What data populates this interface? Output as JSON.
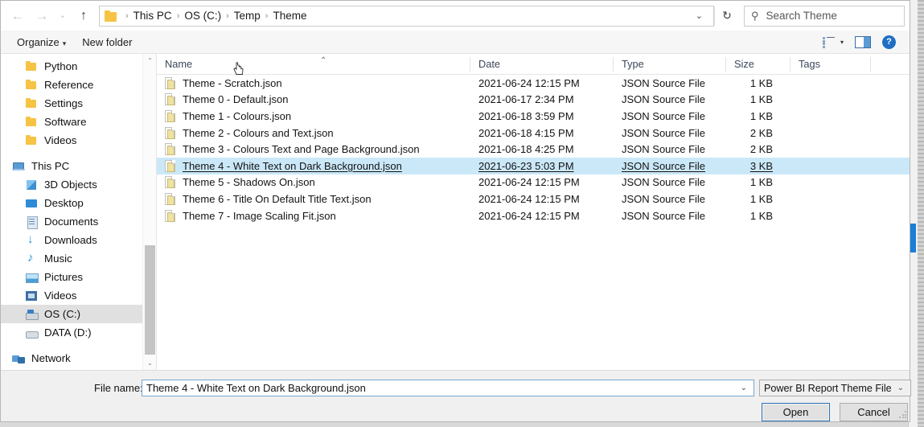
{
  "addressbar": {
    "back_icon": "arrow-left-icon",
    "forward_icon": "arrow-right-icon",
    "recent_icon": "chevron-down-icon",
    "up_icon": "arrow-up-icon",
    "folder_icon": "folder-icon",
    "breadcrumbs": [
      "This PC",
      "OS (C:)",
      "Temp",
      "Theme"
    ],
    "separator": "›",
    "dropdown_icon": "chevron-down-icon",
    "refresh_icon": "refresh-icon",
    "refresh_glyph": "↻"
  },
  "search": {
    "icon": "search-icon",
    "placeholder": "Search Theme",
    "value": ""
  },
  "commandbar": {
    "organize_label": "Organize",
    "organize_caret": "▾",
    "new_folder_label": "New folder",
    "view_icon": "view-options-icon",
    "view_caret": "▾",
    "preview_pane_icon": "preview-pane-icon",
    "help_icon": "help-icon",
    "help_glyph": "?"
  },
  "sidebar": {
    "items": [
      {
        "label": "Python",
        "icon": "folder-icon",
        "icon_class": "ic-folder",
        "level": "child",
        "selected": false
      },
      {
        "label": "Reference",
        "icon": "folder-icon",
        "icon_class": "ic-folder",
        "level": "child",
        "selected": false
      },
      {
        "label": "Settings",
        "icon": "folder-icon",
        "icon_class": "ic-folder",
        "level": "child",
        "selected": false
      },
      {
        "label": "Software",
        "icon": "folder-icon",
        "icon_class": "ic-folder",
        "level": "child",
        "selected": false
      },
      {
        "label": "Videos",
        "icon": "folder-icon",
        "icon_class": "ic-folder",
        "level": "child",
        "selected": false
      },
      {
        "label": "",
        "icon": "spacer",
        "icon_class": "",
        "level": "gap",
        "selected": false
      },
      {
        "label": "This PC",
        "icon": "this-pc-icon",
        "icon_class": "ic-pc",
        "level": "root",
        "selected": false
      },
      {
        "label": "3D Objects",
        "icon": "3d-objects-icon",
        "icon_class": "ic-3d",
        "level": "child",
        "selected": false
      },
      {
        "label": "Desktop",
        "icon": "desktop-icon",
        "icon_class": "ic-desktop",
        "level": "child",
        "selected": false
      },
      {
        "label": "Documents",
        "icon": "documents-icon",
        "icon_class": "ic-docs",
        "level": "child",
        "selected": false
      },
      {
        "label": "Downloads",
        "icon": "downloads-icon",
        "icon_class": "ic-down",
        "level": "child",
        "selected": false
      },
      {
        "label": "Music",
        "icon": "music-icon",
        "icon_class": "ic-music",
        "level": "child",
        "selected": false
      },
      {
        "label": "Pictures",
        "icon": "pictures-icon",
        "icon_class": "ic-pics",
        "level": "child",
        "selected": false
      },
      {
        "label": "Videos",
        "icon": "videos-icon",
        "icon_class": "ic-vids",
        "level": "child",
        "selected": false
      },
      {
        "label": "OS (C:)",
        "icon": "drive-icon",
        "icon_class": "ic-drive",
        "level": "child",
        "selected": true
      },
      {
        "label": "DATA (D:)",
        "icon": "drive-icon",
        "icon_class": "ic-drive2",
        "level": "child",
        "selected": false
      },
      {
        "label": "",
        "icon": "spacer",
        "icon_class": "",
        "level": "gap",
        "selected": false
      },
      {
        "label": "Network",
        "icon": "network-icon",
        "icon_class": "ic-net",
        "level": "root",
        "selected": false
      }
    ],
    "scroll_up_glyph": "⌃",
    "scroll_down_glyph": "⌄"
  },
  "filelist": {
    "sort_indicator": "⌃",
    "columns": [
      {
        "label": "Name",
        "key": "name"
      },
      {
        "label": "Date",
        "key": "date"
      },
      {
        "label": "Type",
        "key": "type"
      },
      {
        "label": "Size",
        "key": "size"
      },
      {
        "label": "Tags",
        "key": "tags"
      }
    ],
    "rows": [
      {
        "name": "Theme - Scratch.json",
        "date": "2021-06-24 12:15 PM",
        "type": "JSON Source File",
        "size": "1 KB",
        "tags": "",
        "selected": false
      },
      {
        "name": "Theme 0 - Default.json",
        "date": "2021-06-17 2:34 PM",
        "type": "JSON Source File",
        "size": "1 KB",
        "tags": "",
        "selected": false
      },
      {
        "name": "Theme 1 - Colours.json",
        "date": "2021-06-18 3:59 PM",
        "type": "JSON Source File",
        "size": "1 KB",
        "tags": "",
        "selected": false
      },
      {
        "name": "Theme 2 - Colours and Text.json",
        "date": "2021-06-18 4:15 PM",
        "type": "JSON Source File",
        "size": "2 KB",
        "tags": "",
        "selected": false
      },
      {
        "name": "Theme 3 - Colours Text and Page Background.json",
        "date": "2021-06-18 4:25 PM",
        "type": "JSON Source File",
        "size": "2 KB",
        "tags": "",
        "selected": false
      },
      {
        "name": "Theme 4 - White Text on Dark Background.json",
        "date": "2021-06-23 5:03 PM",
        "type": "JSON Source File",
        "size": "3 KB",
        "tags": "",
        "selected": true
      },
      {
        "name": "Theme 5 - Shadows On.json",
        "date": "2021-06-24 12:15 PM",
        "type": "JSON Source File",
        "size": "1 KB",
        "tags": "",
        "selected": false
      },
      {
        "name": "Theme 6 - Title On Default Title Text.json",
        "date": "2021-06-24 12:15 PM",
        "type": "JSON Source File",
        "size": "1 KB",
        "tags": "",
        "selected": false
      },
      {
        "name": "Theme 7 - Image Scaling Fit.json",
        "date": "2021-06-24 12:15 PM",
        "type": "JSON Source File",
        "size": "1 KB",
        "tags": "",
        "selected": false
      }
    ],
    "file_icon": "json-file-icon",
    "cursor_icon": "hand-pointer-cursor"
  },
  "footer": {
    "filename_label": "File name:",
    "filename_value": "Theme 4 - White Text on Dark Background.json",
    "filename_dropdown_icon": "chevron-down-icon",
    "filetype_value": "Power BI Report Theme Files (*.j",
    "filetype_dropdown_icon": "chevron-down-icon",
    "open_label": "Open",
    "cancel_label": "Cancel",
    "resize_grip_icon": "resize-grip-icon"
  },
  "colors": {
    "selection_blue": "#cbe8f8",
    "sidebar_selection": "#e0e0e0",
    "accent_blue": "#1e6fc4",
    "folder_yellow": "#f6c344",
    "header_text": "#39475a"
  }
}
